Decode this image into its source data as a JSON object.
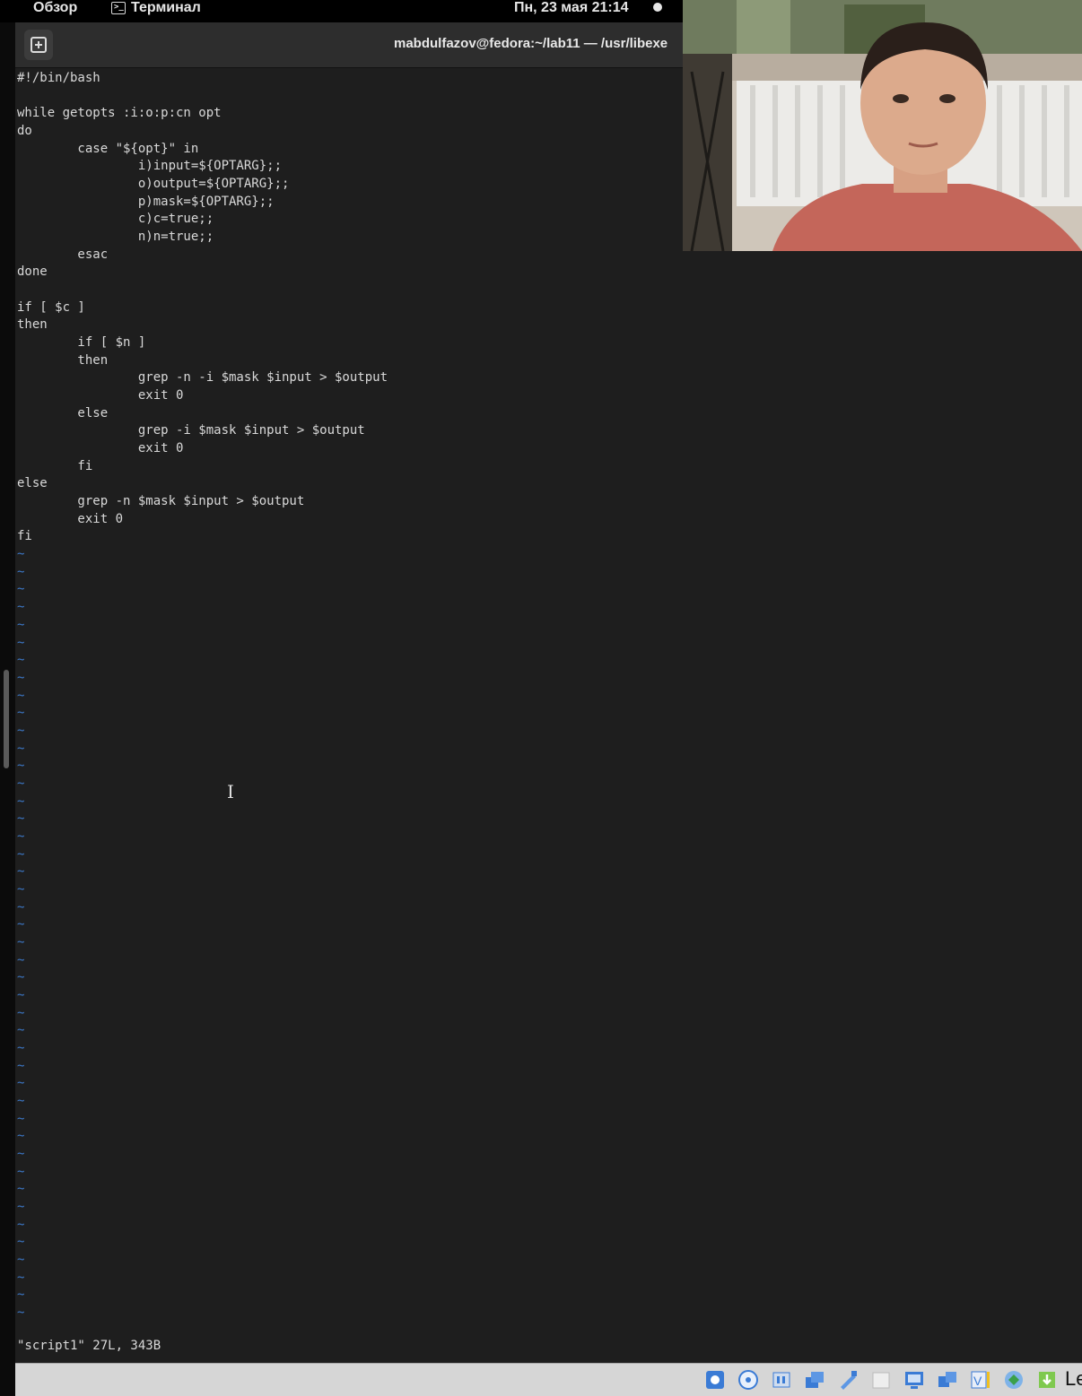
{
  "topbar": {
    "overview_label": "Обзор",
    "app_label": "Терминал",
    "app_icon_glyph": ">_",
    "clock": "Пн, 23 мая  21:14"
  },
  "window": {
    "title": "mabdulfazov@fedora:~/lab11 — /usr/libexe",
    "new_tab_glyph": "⊞"
  },
  "editor": {
    "lines": [
      "#!/bin/bash",
      "",
      "while getopts :i:o:p:cn opt",
      "do",
      "        case \"${opt}\" in",
      "                i)input=${OPTARG};;",
      "                o)output=${OPTARG};;",
      "                p)mask=${OPTARG};;",
      "                c)c=true;;",
      "                n)n=true;;",
      "        esac",
      "done",
      "",
      "if [ $c ]",
      "then",
      "        if [ $n ]",
      "        then",
      "                grep -n -i $mask $input > $output",
      "                exit 0",
      "        else",
      "                grep -i $mask $input > $output",
      "                exit 0",
      "        fi",
      "else",
      "        grep -n $mask $input > $output",
      "        exit 0",
      "fi"
    ],
    "empty_line_marker": "~",
    "empty_line_count": 44,
    "status_line": "\"script1\" 27L, 343B"
  },
  "vbox_bar": {
    "icons": [
      "hard-disk-icon",
      "optical-drive-icon",
      "audio-icon",
      "network-icon",
      "usb-icon",
      "shared-folders-icon",
      "display-icon",
      "snapshot-icon",
      "video-capture-icon",
      "mouse-integration-icon",
      "keyboard-capture-icon"
    ],
    "host_key_label": "Le"
  }
}
